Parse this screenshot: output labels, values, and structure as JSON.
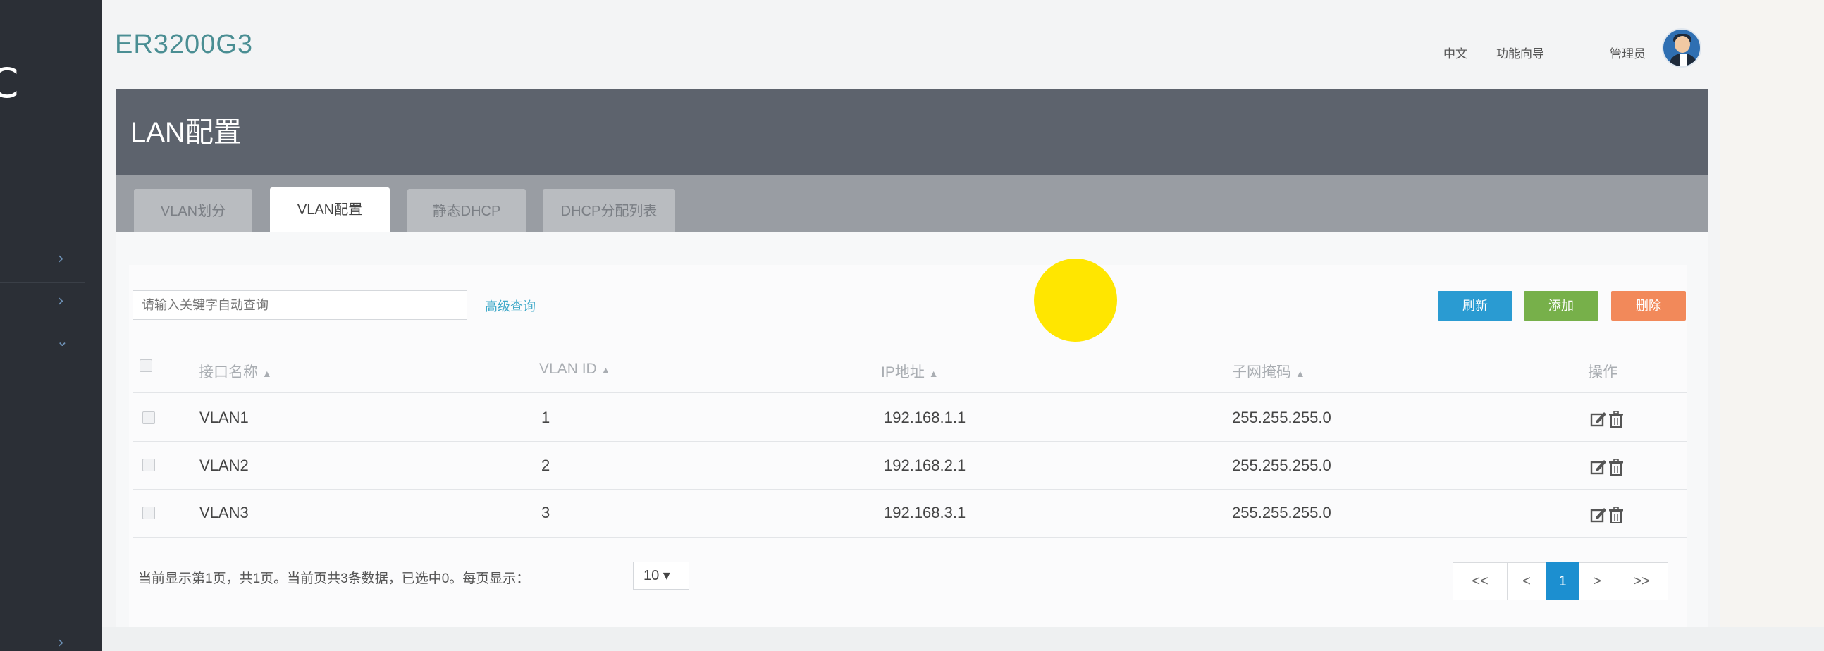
{
  "header": {
    "brand": "ER3200G3",
    "lang": "中文",
    "wizard": "功能向导",
    "user": "管理员"
  },
  "sidebar": {
    "logo_letter": "C"
  },
  "page": {
    "title": "LAN配置",
    "tabs": [
      {
        "label": "VLAN划分",
        "active": false
      },
      {
        "label": "VLAN配置",
        "active": true
      },
      {
        "label": "静态DHCP",
        "active": false
      },
      {
        "label": "DHCP分配列表",
        "active": false
      }
    ]
  },
  "toolbar": {
    "search_placeholder": "请输入关键字自动查询",
    "advanced_search": "高级查询",
    "refresh": "刷新",
    "add": "添加",
    "delete": "删除"
  },
  "table": {
    "columns": [
      "接口名称",
      "VLAN ID",
      "IP地址",
      "子网掩码",
      "操作"
    ],
    "sort_arrow": "▲",
    "rows": [
      {
        "name": "VLAN1",
        "vlan_id": "1",
        "ip": "192.168.1.1",
        "mask": "255.255.255.0"
      },
      {
        "name": "VLAN2",
        "vlan_id": "2",
        "ip": "192.168.2.1",
        "mask": "255.255.255.0"
      },
      {
        "name": "VLAN3",
        "vlan_id": "3",
        "ip": "192.168.3.1",
        "mask": "255.255.255.0"
      }
    ]
  },
  "footer": {
    "summary": "当前显示第1页，共1页。当前页共3条数据，已选中0。每页显示：",
    "page_size": "10 ▾",
    "pager": {
      "first": "<<",
      "prev": "<",
      "current": "1",
      "next": ">",
      "last": ">>"
    }
  },
  "colors": {
    "brand": "#4a8e93",
    "refresh": "#2a9bd2",
    "add": "#77b04a",
    "delete": "#f2895a",
    "page_active": "#1c8fd0",
    "marker": "#ffe600"
  }
}
